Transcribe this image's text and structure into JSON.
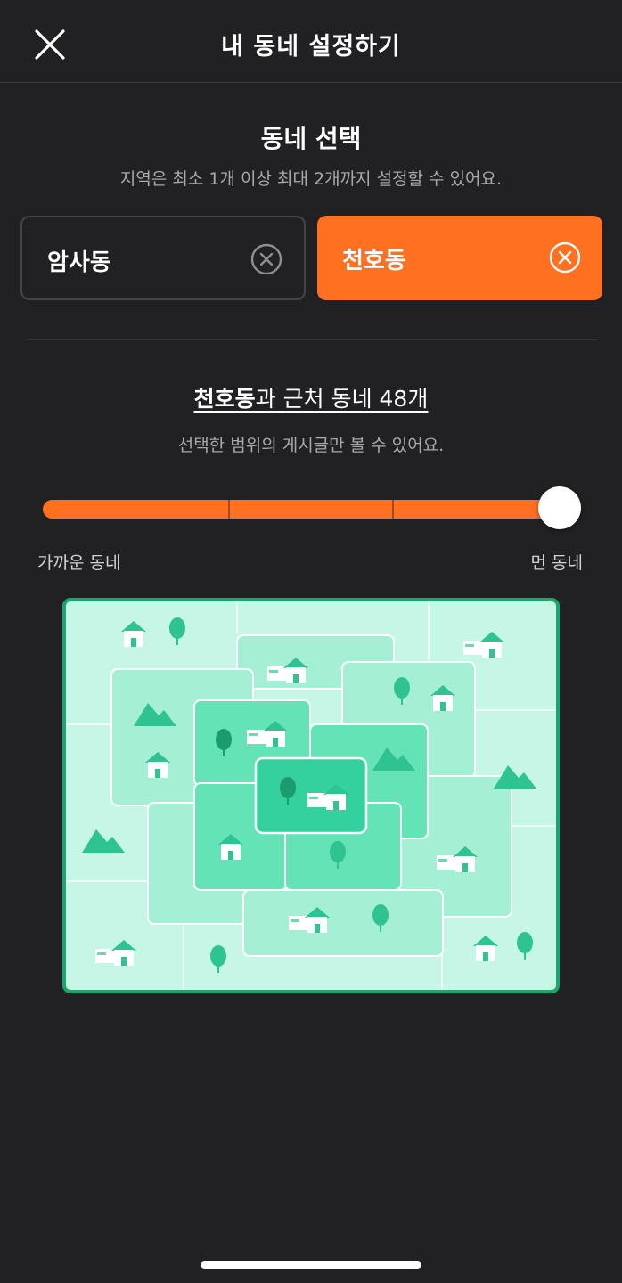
{
  "header": {
    "title": "내 동네 설정하기",
    "close_icon": "close-icon"
  },
  "neighborhood_select": {
    "title": "동네 선택",
    "subtitle": "지역은 최소 1개 이상 최대 2개까지 설정할 수 있어요.",
    "chips": [
      {
        "label": "암사동",
        "selected": false,
        "remove_icon": "remove-circle-icon"
      },
      {
        "label": "천호동",
        "selected": true,
        "remove_icon": "remove-circle-icon"
      }
    ]
  },
  "range": {
    "place": "천호동",
    "suffix": "과 근처 동네 48개",
    "subtitle": "선택한 범위의 게시글만 볼 수 있어요.",
    "level": 4,
    "levels": 4,
    "near_label": "가까운 동네",
    "far_label": "먼 동네"
  },
  "colors": {
    "background": "#212124",
    "accent": "#ff7021",
    "map_border": "#1aa66f"
  },
  "illustration": "neighborhood-map-illustration"
}
